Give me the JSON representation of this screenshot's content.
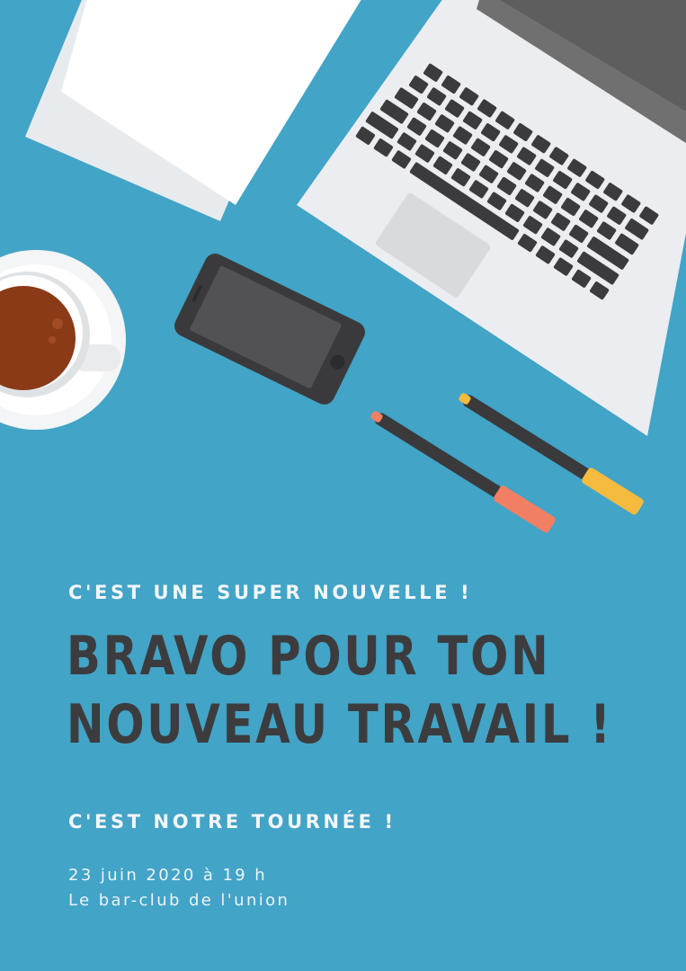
{
  "poster": {
    "tagline": "C'EST UNE SUPER NOUVELLE !",
    "headline_line1": "BRAVO POUR TON",
    "headline_line2": "NOUVEAU TRAVAIL !",
    "invite": "C'EST NOTRE TOURNÉE !",
    "date_time": "23 juin 2020 à 19 h",
    "venue": "Le bar-club de l'union"
  },
  "colors": {
    "background": "#42a4c6",
    "headline": "#3c3c3e",
    "light_text": "#f3f6f8"
  },
  "icons": [
    "papers-icon",
    "laptop-icon",
    "smartphone-icon",
    "coffee-cup-icon",
    "pen-icon",
    "marker-icon"
  ]
}
